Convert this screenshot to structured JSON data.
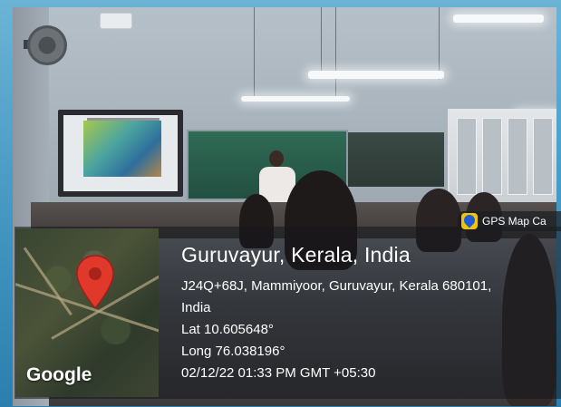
{
  "overlay": {
    "app_badge": "GPS Map Ca",
    "place": "Guruvayur, Kerala, India",
    "address_line1": "J24Q+68J, Mammiyoor, Guruvayur, Kerala 680101,",
    "address_line2": "India",
    "latitude": "Lat 10.605648°",
    "longitude": "Long 76.038196°",
    "datetime": "02/12/22 01:33 PM GMT +05:30",
    "map_brand": "Google"
  },
  "colors": {
    "frame": "#3f93bf",
    "pin": "#e0392b",
    "badge_icon": "#f2c400"
  },
  "icons": [
    "location-pin-icon",
    "gps-map-camera-icon"
  ]
}
